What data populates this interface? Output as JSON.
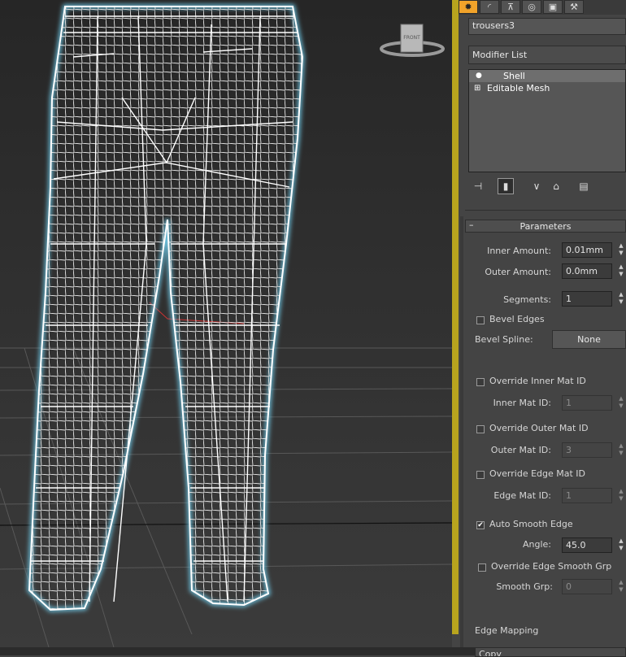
{
  "viewcube": {
    "label": "FRONT"
  },
  "command_panel": {
    "tabs": [
      {
        "name": "create-tab",
        "icon": "sun-icon"
      },
      {
        "name": "modify-tab",
        "icon": "arc-icon"
      },
      {
        "name": "hierarchy-tab",
        "icon": "hierarchy-icon"
      },
      {
        "name": "motion-tab",
        "icon": "motion-icon"
      },
      {
        "name": "display-tab",
        "icon": "display-icon"
      },
      {
        "name": "utilities-tab",
        "icon": "hammer-icon"
      }
    ],
    "object_name": "trousers3",
    "modifier_list": "Modifier List",
    "stack": [
      {
        "label": "Shell",
        "icon": "lightbulb-icon"
      },
      {
        "label": "Editable Mesh",
        "icon": "plus-box-icon"
      }
    ],
    "toolbar": [
      "pin-stack-icon",
      "show-end-result-icon",
      "make-unique-icon",
      "remove-modifier-icon",
      "configure-sets-icon"
    ]
  },
  "parameters": {
    "rollout_toggle": "–",
    "title": "Parameters",
    "inner_amount": {
      "label": "Inner Amount:",
      "value": "0.01mm"
    },
    "outer_amount": {
      "label": "Outer Amount:",
      "value": "0.0mm"
    },
    "segments": {
      "label": "Segments:",
      "value": "1"
    },
    "bevel_edges": {
      "label": "Bevel Edges",
      "checked": false
    },
    "bevel_spline": {
      "label": "Bevel Spline:",
      "value": "None"
    },
    "override_inner": {
      "label": "Override Inner Mat ID",
      "checked": false
    },
    "inner_mat_id": {
      "label": "Inner Mat ID:",
      "value": "1"
    },
    "override_outer": {
      "label": "Override Outer Mat ID",
      "checked": false
    },
    "outer_mat_id": {
      "label": "Outer Mat ID:",
      "value": "3"
    },
    "override_edge": {
      "label": "Override Edge Mat ID",
      "checked": false
    },
    "edge_mat_id": {
      "label": "Edge Mat ID:",
      "value": "1"
    },
    "auto_smooth": {
      "label": "Auto Smooth Edge",
      "checked": true,
      "check_glyph": "✔"
    },
    "angle": {
      "label": "Angle:",
      "value": "45.0"
    },
    "override_smooth": {
      "label": "Override Edge Smooth Grp",
      "checked": false
    },
    "smooth_grp": {
      "label": "Smooth Grp:",
      "value": "0"
    },
    "edge_mapping": {
      "label": "Edge Mapping",
      "value": "Copy"
    }
  },
  "colors": {
    "accent": "#f1a32a",
    "viewport_border": "#b8a41e",
    "wire": "#ffffff",
    "selection_glow": "#6ec8e6"
  }
}
